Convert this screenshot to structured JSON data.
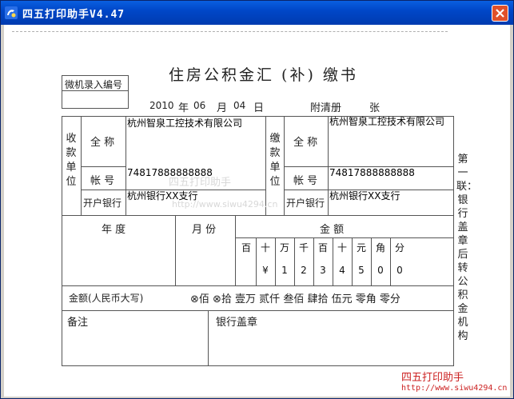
{
  "window": {
    "title": "四五打印助手V4.47",
    "app_icon": "printer-assistant-icon",
    "close_icon": "close-icon",
    "title_color": "#0a5fe0"
  },
  "form": {
    "title": "住房公积金汇 (补) 缴书",
    "entry_no_label": "微机录入编号",
    "date": {
      "year": "2010",
      "year_unit": "年",
      "month": "06",
      "month_unit": "月",
      "day": "04",
      "day_unit": "日"
    },
    "attachment_label": "附清册",
    "attachment_unit": "张",
    "payee": {
      "group_label": "收款单位",
      "name_label": "全 称",
      "name": "杭州智泉工控技术有限公司",
      "account_label": "帐 号",
      "account": "74817888888888",
      "bank_label": "开户银行",
      "bank": "杭州银行XX支行"
    },
    "payer": {
      "group_label": "缴款单位",
      "name_label": "全 称",
      "name": "杭州智泉工控技术有限公司",
      "account_label": "帐 号",
      "account": "74817888888888",
      "bank_label": "开户银行",
      "bank": "杭州银行XX支行"
    },
    "year_label": "年 度",
    "month_label": "月 份",
    "amount_label": "金 额",
    "digit_units": [
      "百",
      "十",
      "万",
      "千",
      "百",
      "十",
      "元",
      "角",
      "分"
    ],
    "digits": [
      "",
      "¥",
      "1",
      "2",
      "3",
      "4",
      "5",
      "0",
      "0"
    ],
    "rmb_label": "金额(人民币大写)",
    "rmb_text": "⊗佰 ⊗拾 壹万 贰仟 叁佰 肆拾 伍元 零角 零分",
    "remark_label": "备注",
    "bank_seal_label": "银行盖章",
    "side_note": "第一联：银行盖章后转公积金机构"
  },
  "watermark": {
    "name": "四五打印助手",
    "url": "http://www.siwu4294.cn",
    "color": "#cc2222"
  }
}
